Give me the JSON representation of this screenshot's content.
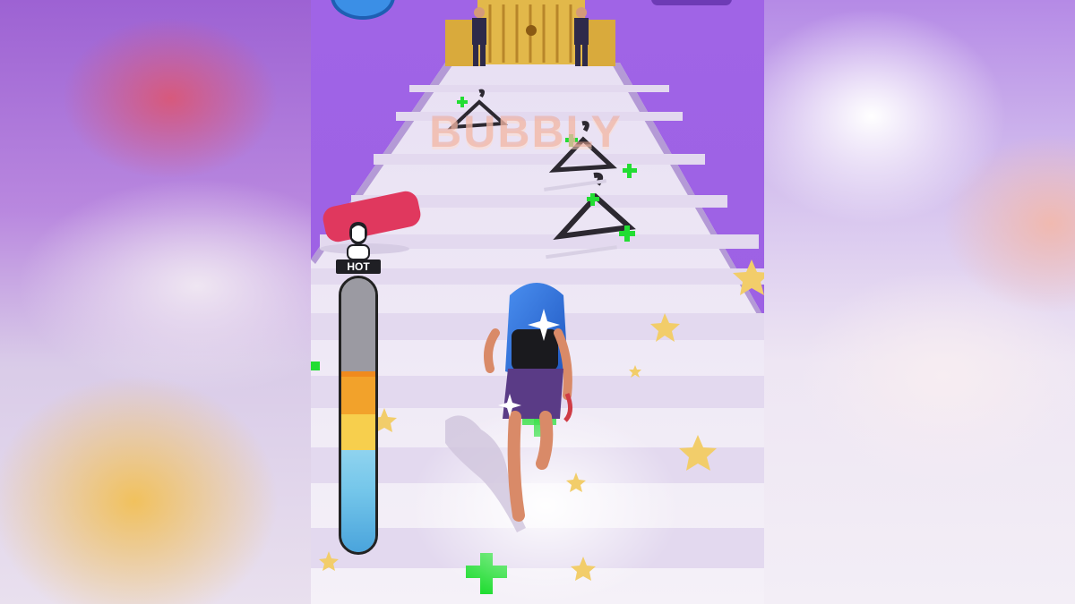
{
  "game": {
    "brand_text": "BUBBLY",
    "meter": {
      "label": "HOT",
      "level_fraction": 0.38,
      "segments": [
        "blue",
        "yellow",
        "orange",
        "gray"
      ]
    }
  },
  "colors": {
    "background_purple": "#9c60e4",
    "runway": "#f1ecf6",
    "hair": "#2f6fd8",
    "skirt": "#5a3b86",
    "pickup_green": "#22dd33",
    "star": "#f2cd6a",
    "towel": "#e0385e"
  },
  "icons": [
    "hanger-icon",
    "plus-icon",
    "star-icon",
    "sparkle-icon",
    "mannequin-icon"
  ]
}
